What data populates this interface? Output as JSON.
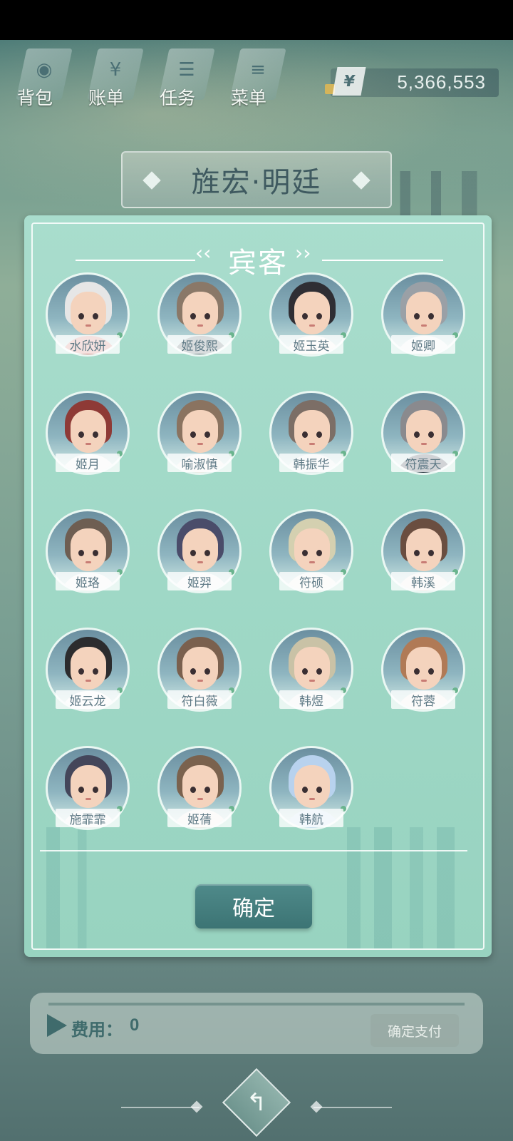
{
  "top_menu": [
    {
      "label": "背包",
      "icon": "backpack-icon",
      "glyph": "◉"
    },
    {
      "label": "账单",
      "icon": "bill-icon",
      "glyph": "¥"
    },
    {
      "label": "任务",
      "icon": "task-icon",
      "glyph": "☰"
    },
    {
      "label": "菜单",
      "icon": "menu-icon",
      "glyph": "≡"
    }
  ],
  "money": {
    "symbol": "¥",
    "value": "5,366,553"
  },
  "location": {
    "title": "旌宏·明廷"
  },
  "modal": {
    "title": "宾客",
    "confirm_label": "确定",
    "guests": [
      {
        "name": "水欣妍",
        "hair": "#e6e6e6",
        "clothes": "#d07a74"
      },
      {
        "name": "姬俊熙",
        "hair": "#8a7868",
        "clothes": "#55656a"
      },
      {
        "name": "姬玉英",
        "hair": "#2f2e34",
        "clothes": "#f4f0ec"
      },
      {
        "name": "姬卿",
        "hair": "#9aa0a6",
        "clothes": "#eef0f0"
      },
      {
        "name": "姬月",
        "hair": "#8e3a36",
        "clothes": "#f2f2f2"
      },
      {
        "name": "喻淑慎",
        "hair": "#8a7360",
        "clothes": "#f0ece6"
      },
      {
        "name": "韩振华",
        "hair": "#7c6e66",
        "clothes": "#e8ecee"
      },
      {
        "name": "符震天",
        "hair": "#8a8a8e",
        "clothes": "#2f3a44"
      },
      {
        "name": "姬珞",
        "hair": "#6e5e52",
        "clothes": "#f2f2f2"
      },
      {
        "name": "姬羿",
        "hair": "#4a4c6a",
        "clothes": "#f0f0f0"
      },
      {
        "name": "符硕",
        "hair": "#d4d0b0",
        "clothes": "#f2f2ee"
      },
      {
        "name": "韩溪",
        "hair": "#6a4e40",
        "clothes": "#f0ece8"
      },
      {
        "name": "姬云龙",
        "hair": "#2c2c2e",
        "clothes": "#f4f4f4"
      },
      {
        "name": "符白薇",
        "hair": "#7a604e",
        "clothes": "#f2eee8"
      },
      {
        "name": "韩煜",
        "hair": "#c9c2a6",
        "clothes": "#eeeeea"
      },
      {
        "name": "符蓉",
        "hair": "#b07a56",
        "clothes": "#f0ece6"
      },
      {
        "name": "施霏霏",
        "hair": "#44465a",
        "clothes": "#f2f2f2"
      },
      {
        "name": "姬蒨",
        "hair": "#7a624e",
        "clothes": "#f0ece8"
      },
      {
        "name": "韩航",
        "hair": "#b8d2ee",
        "clothes": "#c8ddf0"
      }
    ]
  },
  "cost": {
    "label": "费用：",
    "value": "0",
    "pay_label": "确定支付"
  },
  "colors": {
    "accent": "#3f6b6c",
    "modal_bg": "#a9ddcd",
    "online_dot": "#6ab48e"
  }
}
